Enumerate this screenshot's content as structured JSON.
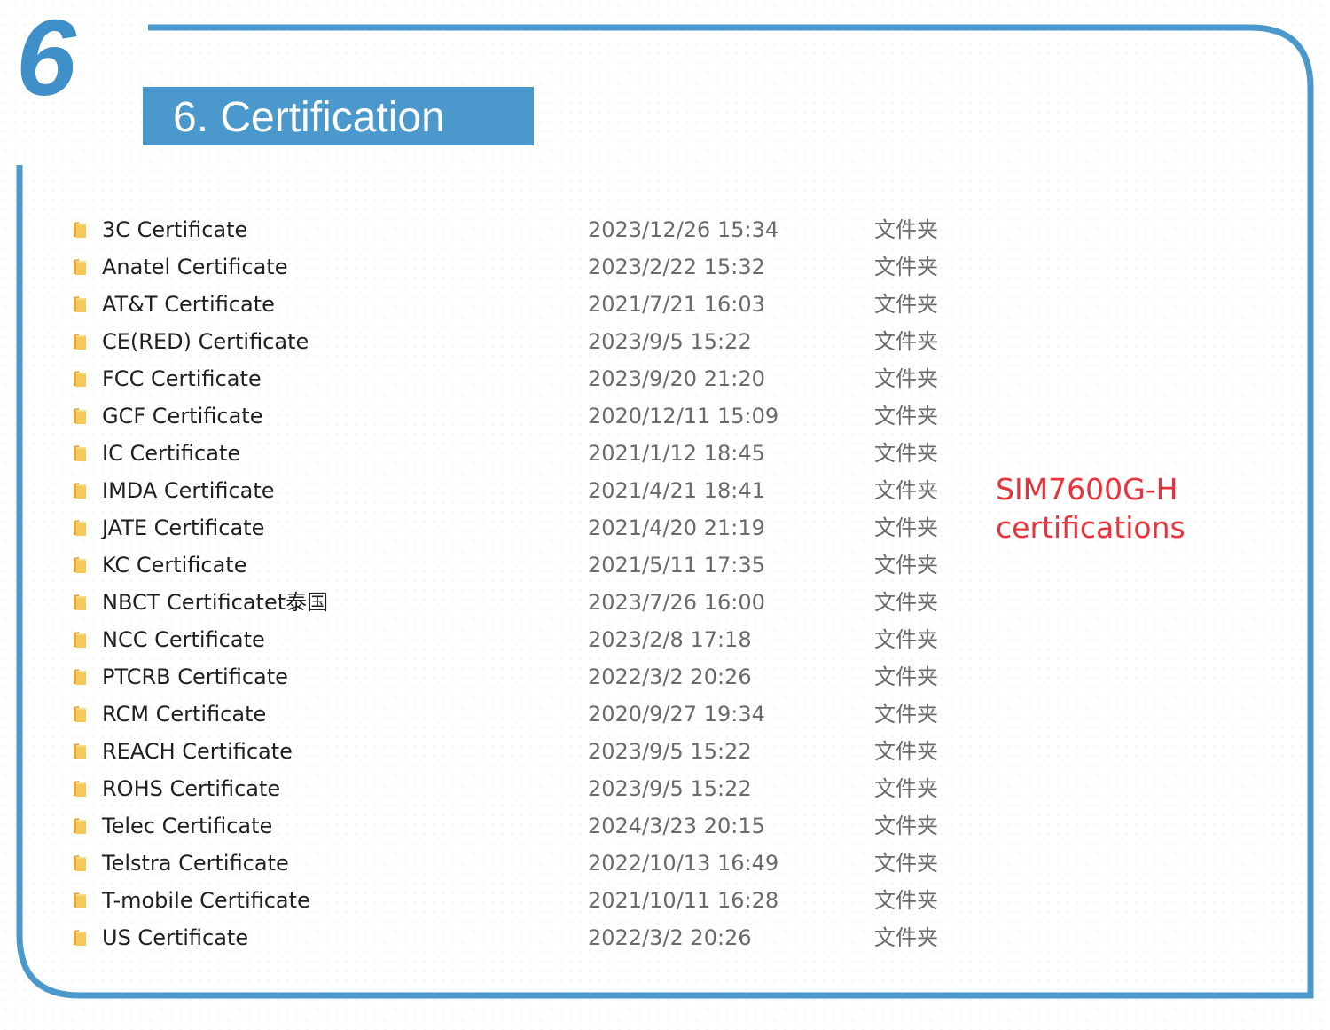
{
  "section": {
    "number": "6",
    "title": "6. Certification"
  },
  "colors": {
    "frame": "#4a98cc",
    "title_bar": "#4a98cc",
    "annotation": "#e8333a",
    "folder_icon": "#f2c14e"
  },
  "files": [
    {
      "icon": "folder-icon",
      "name": "3C Certificate",
      "date": "2023/12/26 15:34",
      "type": "文件夹"
    },
    {
      "icon": "folder-icon",
      "name": "Anatel Certificate",
      "date": "2023/2/22 15:32",
      "type": "文件夹"
    },
    {
      "icon": "folder-icon",
      "name": "AT&T Certificate",
      "date": "2021/7/21 16:03",
      "type": "文件夹"
    },
    {
      "icon": "folder-icon",
      "name": "CE(RED) Certificate",
      "date": "2023/9/5 15:22",
      "type": "文件夹"
    },
    {
      "icon": "folder-icon",
      "name": "FCC Certificate",
      "date": "2023/9/20 21:20",
      "type": "文件夹"
    },
    {
      "icon": "folder-icon",
      "name": "GCF Certificate",
      "date": "2020/12/11 15:09",
      "type": "文件夹"
    },
    {
      "icon": "folder-icon",
      "name": "IC Certificate",
      "date": "2021/1/12 18:45",
      "type": "文件夹"
    },
    {
      "icon": "folder-icon",
      "name": "IMDA Certificate",
      "date": "2021/4/21 18:41",
      "type": "文件夹"
    },
    {
      "icon": "folder-icon",
      "name": "JATE Certificate",
      "date": "2021/4/20 21:19",
      "type": "文件夹"
    },
    {
      "icon": "folder-icon",
      "name": "KC Certificate",
      "date": "2021/5/11 17:35",
      "type": "文件夹"
    },
    {
      "icon": "folder-icon",
      "name": "NBCT Certificatet泰国",
      "date": "2023/7/26 16:00",
      "type": "文件夹"
    },
    {
      "icon": "folder-icon",
      "name": "NCC Certificate",
      "date": "2023/2/8 17:18",
      "type": "文件夹"
    },
    {
      "icon": "folder-icon",
      "name": "PTCRB Certificate",
      "date": "2022/3/2 20:26",
      "type": "文件夹"
    },
    {
      "icon": "folder-icon",
      "name": "RCM Certificate",
      "date": "2020/9/27 19:34",
      "type": "文件夹"
    },
    {
      "icon": "folder-icon",
      "name": "REACH Certificate",
      "date": "2023/9/5 15:22",
      "type": "文件夹"
    },
    {
      "icon": "folder-icon",
      "name": "ROHS Certificate",
      "date": "2023/9/5 15:22",
      "type": "文件夹"
    },
    {
      "icon": "folder-icon",
      "name": "Telec Certificate",
      "date": "2024/3/23 20:15",
      "type": "文件夹"
    },
    {
      "icon": "folder-icon",
      "name": "Telstra Certificate",
      "date": "2022/10/13 16:49",
      "type": "文件夹"
    },
    {
      "icon": "folder-icon",
      "name": "T-mobile Certificate",
      "date": "2021/10/11 16:28",
      "type": "文件夹"
    },
    {
      "icon": "folder-icon",
      "name": "US Certificate",
      "date": "2022/3/2 20:26",
      "type": "文件夹"
    }
  ],
  "annotation": {
    "line1": "SIM7600G-H",
    "line2": "certifications"
  }
}
